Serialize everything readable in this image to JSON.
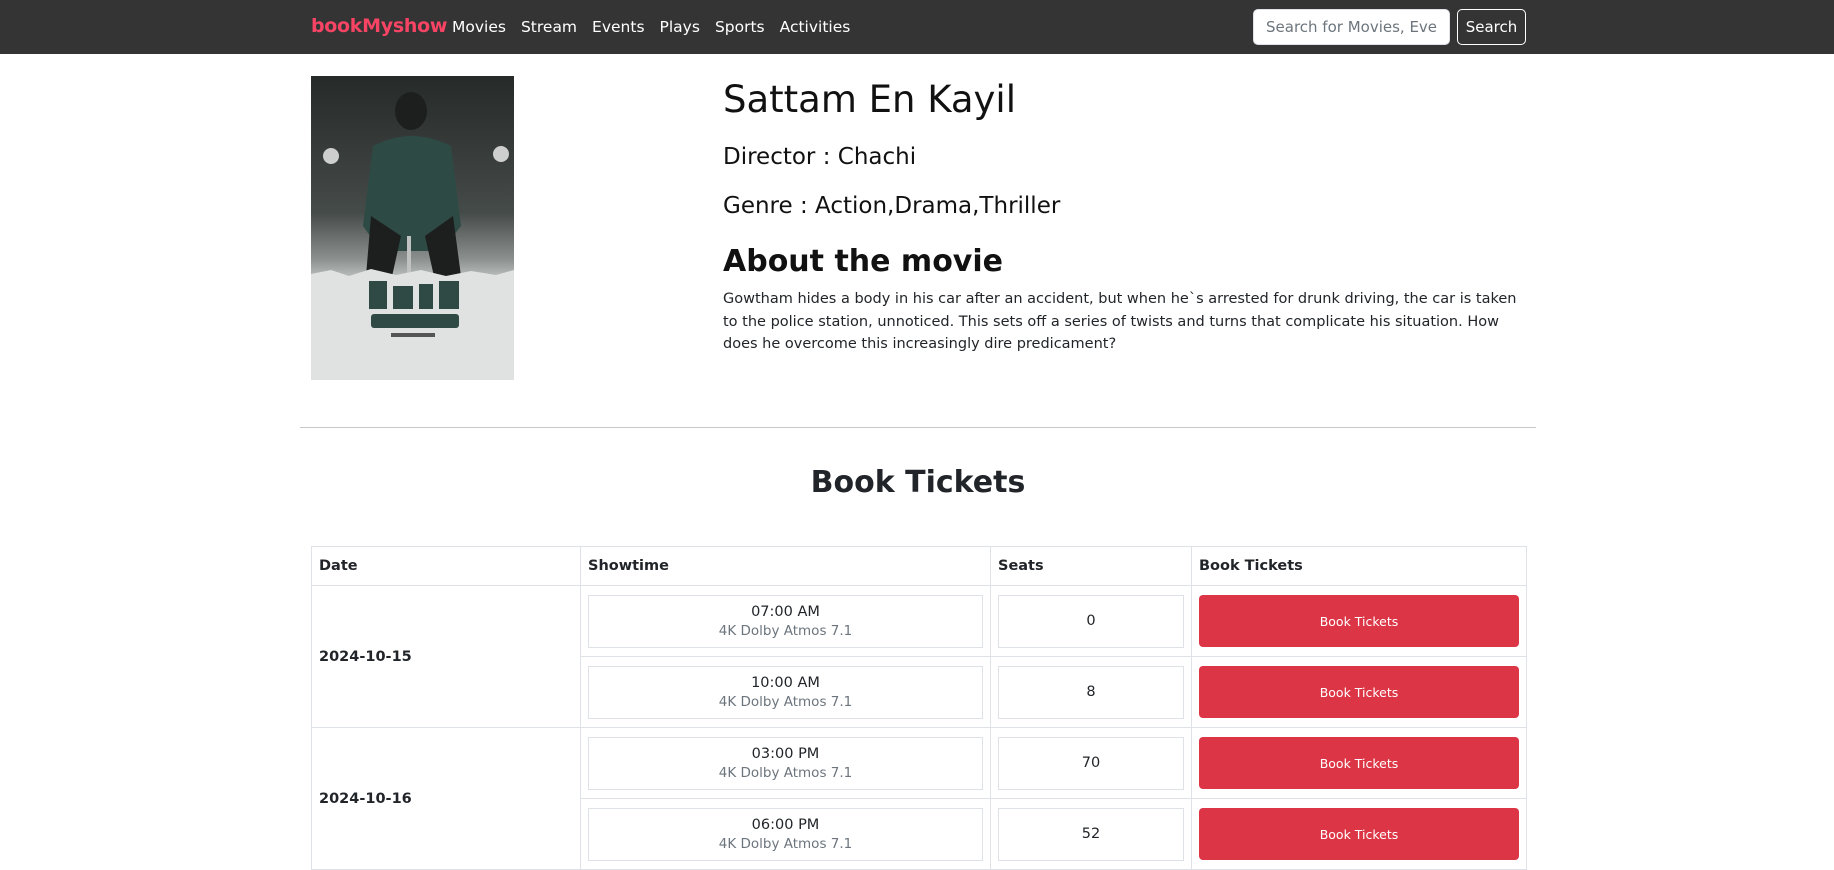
{
  "navbar": {
    "brand": "bookMyshow",
    "links": [
      "Movies",
      "Stream",
      "Events",
      "Plays",
      "Sports",
      "Activities"
    ],
    "search_placeholder": "Search for Movies, Events",
    "search_button": "Search",
    "brand_color": "#f84464",
    "background_color": "#343434"
  },
  "movie": {
    "title": "Sattam En Kayil",
    "director": "Director : Chachi",
    "genre": "Genre : Action,Drama,Thriller",
    "about_heading": "About the movie",
    "about_text": "Gowtham hides a body in his car after an accident, but when he`s arrested for drunk driving, the car is taken to the police station, unnoticed. This sets off a series of twists and turns that complicate his situation. How does he overcome this increasingly dire predicament?"
  },
  "booking": {
    "heading": "Book Tickets",
    "columns": [
      "Date",
      "Showtime",
      "Seats",
      "Book Tickets"
    ],
    "dates": [
      {
        "date": "2024-10-15",
        "shows": [
          {
            "time": "07:00 AM",
            "format": "4K Dolby Atmos 7.1",
            "seats": "0",
            "button": "Book Tickets"
          },
          {
            "time": "10:00 AM",
            "format": "4K Dolby Atmos 7.1",
            "seats": "8",
            "button": "Book Tickets"
          }
        ]
      },
      {
        "date": "2024-10-16",
        "shows": [
          {
            "time": "03:00 PM",
            "format": "4K Dolby Atmos 7.1",
            "seats": "70",
            "button": "Book Tickets"
          },
          {
            "time": "06:00 PM",
            "format": "4K Dolby Atmos 7.1",
            "seats": "52",
            "button": "Book Tickets"
          }
        ]
      }
    ],
    "button_color": "#dc3545"
  }
}
